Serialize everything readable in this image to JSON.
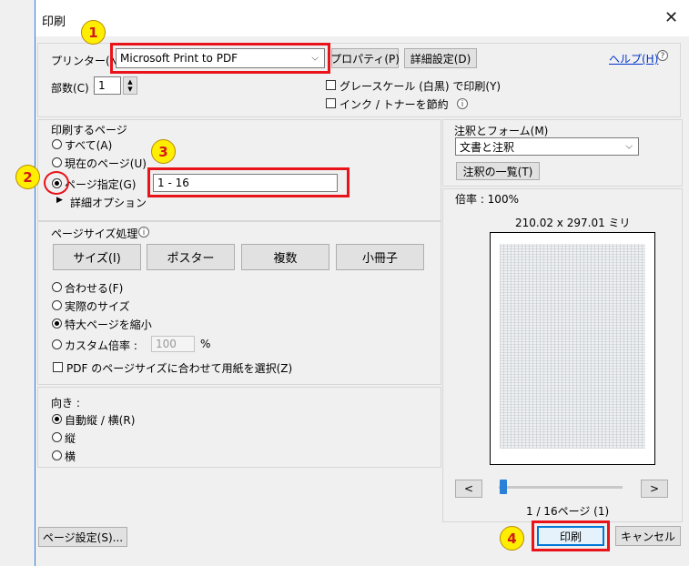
{
  "window": {
    "title": "印刷",
    "close_glyph": "✕"
  },
  "printer": {
    "label": "プリンター(N)",
    "selected": "Microsoft Print to PDF",
    "properties_button": "プロパティ(P)",
    "advanced_button": "詳細設定(D)",
    "help_link": "ヘルプ(H)",
    "copies_label": "部数(C) :",
    "copies_value": "1",
    "grayscale_label": "グレースケール (白黒) で印刷(Y)",
    "save_ink_label": "インク / トナーを節約"
  },
  "pages": {
    "group_label": "印刷するページ",
    "all": "すべて(A)",
    "current": "現在のページ(U)",
    "range": "ページ指定(G)",
    "range_value": "1 - 16",
    "more_options": "詳細オプション"
  },
  "page_sizing": {
    "group_label": "ページサイズ処理",
    "buttons": [
      "サイズ(I)",
      "ポスター",
      "複数",
      "小冊子"
    ],
    "fit": "合わせる(F)",
    "actual": "実際のサイズ",
    "shrink": "特大ページを縮小",
    "custom": "カスタム倍率 :",
    "custom_value": "100",
    "percent": "%",
    "paper_by_pdf": "PDF のページサイズに合わせて用紙を選択(Z)"
  },
  "orientation": {
    "group_label": "向き :",
    "auto": "自動縦 / 横(R)",
    "portrait": "縦",
    "landscape": "横"
  },
  "comments": {
    "group_label": "注釈とフォーム(M)",
    "selected": "文書と注釈",
    "summary_button": "注釈の一覧(T)"
  },
  "preview": {
    "scale": "倍率 : 100%",
    "size": "210.02 x 297.01 ミリ",
    "prev": "<",
    "next": ">",
    "page_counter": "1 / 16ページ (1)",
    "slider_fraction": 0.0
  },
  "footer": {
    "page_setup": "ページ設定(S)...",
    "print": "印刷",
    "cancel": "キャンセル"
  },
  "callouts": [
    "1",
    "2",
    "3",
    "4"
  ],
  "colors": {
    "highlight": "#e8141a",
    "callout_fill": "#ffee00",
    "callout_text": "#d11a1a",
    "accent": "#2a7fd6"
  }
}
